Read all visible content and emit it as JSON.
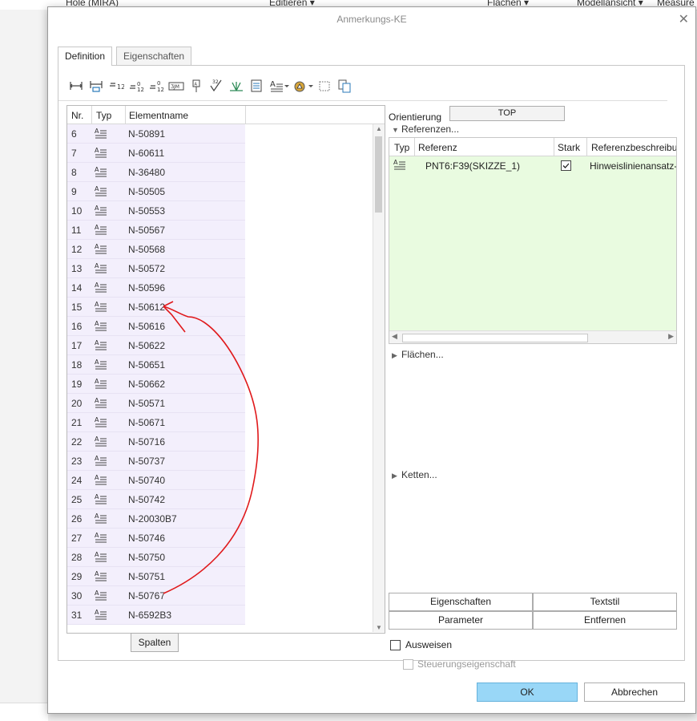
{
  "background": {
    "menu_items": [
      "Hole (MIRA)",
      "Editieren ▾",
      "Flächen ▾",
      "Modellansicht ▾",
      "Measure"
    ]
  },
  "dialog": {
    "title": "Anmerkungs-KE",
    "close_glyph": "✕",
    "tabs": [
      {
        "label": "Definition",
        "active": true
      },
      {
        "label": "Eigenschaften",
        "active": false
      }
    ],
    "toolbar_icons": [
      "dimension-icon",
      "reference-dimension-icon",
      "geometric-tolerance-icon",
      "datum-tolerance-icon",
      "driven-dimension-icon",
      "datum-feature-icon",
      "datum-target-icon",
      "surface-finish-icon",
      "symbol-icon",
      "table-icon",
      "note-icon",
      "note-dropdown-icon",
      "weld-symbol-icon",
      "weld-dropdown-icon",
      "select-box-icon",
      "copy-icon"
    ],
    "list": {
      "columns": {
        "nr": "Nr.",
        "typ": "Typ",
        "name": "Elementname"
      },
      "rows": [
        {
          "nr": "6",
          "name": "N-50891"
        },
        {
          "nr": "7",
          "name": "N-60611"
        },
        {
          "nr": "8",
          "name": "N-36480"
        },
        {
          "nr": "9",
          "name": "N-50505"
        },
        {
          "nr": "10",
          "name": "N-50553"
        },
        {
          "nr": "11",
          "name": "N-50567"
        },
        {
          "nr": "12",
          "name": "N-50568"
        },
        {
          "nr": "13",
          "name": "N-50572"
        },
        {
          "nr": "14",
          "name": "N-50596"
        },
        {
          "nr": "15",
          "name": "N-50612"
        },
        {
          "nr": "16",
          "name": "N-50616"
        },
        {
          "nr": "17",
          "name": "N-50622"
        },
        {
          "nr": "18",
          "name": "N-50651"
        },
        {
          "nr": "19",
          "name": "N-50662"
        },
        {
          "nr": "20",
          "name": "N-50571"
        },
        {
          "nr": "21",
          "name": "N-50671"
        },
        {
          "nr": "22",
          "name": "N-50716"
        },
        {
          "nr": "23",
          "name": "N-50737"
        },
        {
          "nr": "24",
          "name": "N-50740"
        },
        {
          "nr": "25",
          "name": "N-50742"
        },
        {
          "nr": "26",
          "name": "N-20030B7"
        },
        {
          "nr": "27",
          "name": "N-50746"
        },
        {
          "nr": "28",
          "name": "N-50750"
        },
        {
          "nr": "29",
          "name": "N-50751"
        },
        {
          "nr": "30",
          "name": "N-50767"
        },
        {
          "nr": "31",
          "name": "N-6592B3"
        }
      ],
      "columns_button": "Spalten"
    },
    "right": {
      "orientation_label": "Orientierung",
      "orientation_value": "TOP",
      "references_label": "Referenzen...",
      "ref_table": {
        "columns": {
          "typ": "Typ",
          "ref": "Referenz",
          "strong": "Stark",
          "desc": "Referenzbeschreibu"
        },
        "rows": [
          {
            "ref": "PNT6:F39(SKIZZE_1)",
            "strong": true,
            "desc": "Hinweislinienansatz-"
          }
        ]
      },
      "surfaces_label": "Flächen...",
      "chains_label": "Ketten...",
      "buttons": {
        "properties": "Eigenschaften",
        "text_style": "Textstil",
        "parameters": "Parameter",
        "remove": "Entfernen"
      },
      "show_label": "Ausweisen",
      "show_checked": false,
      "control_property_label": "Steuerungseigenschaft",
      "control_property_enabled": false
    },
    "footer": {
      "ok": "OK",
      "cancel": "Abbrechen"
    }
  },
  "colors": {
    "row_highlight": "#f3effc",
    "ref_table_bg": "#e9fbe0",
    "ok_button": "#99d7f7",
    "annotation_stroke": "#e0191b"
  }
}
